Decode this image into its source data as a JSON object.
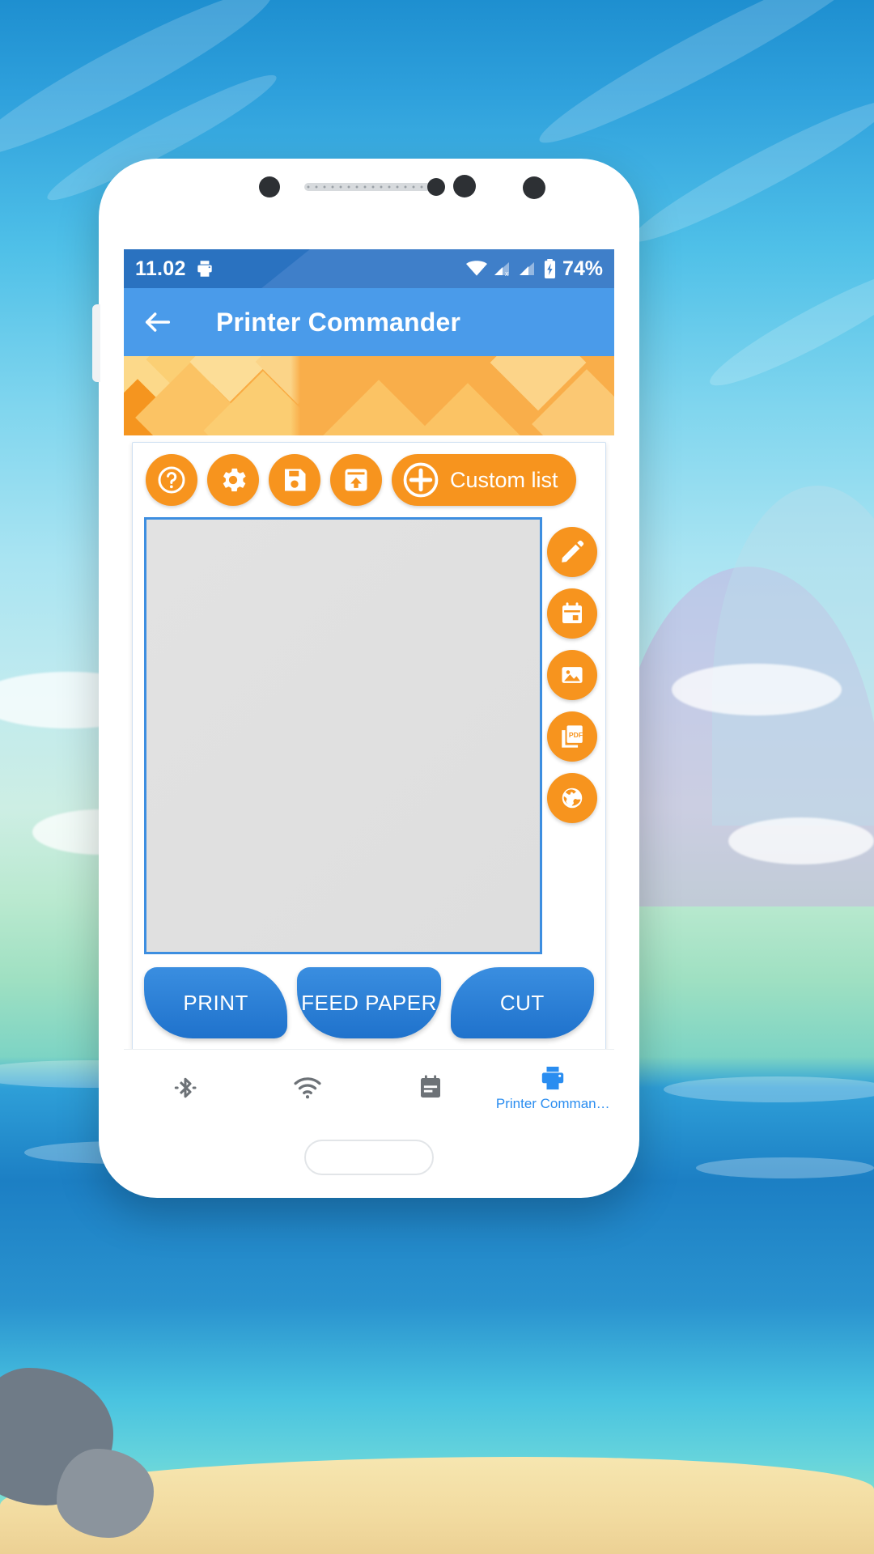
{
  "statusbar": {
    "time": "11.02",
    "printer_icon": "printer-icon",
    "wifi_icon": "wifi-icon",
    "signal1_icon": "cellular-signal-1-icon",
    "signal2_icon": "cellular-signal-2-icon",
    "battery_icon": "battery-charging-icon",
    "battery_text": "74%"
  },
  "appbar": {
    "back_icon": "back-arrow-icon",
    "title": "Printer Commander",
    "bg_color": "#4a9bea"
  },
  "banner": {
    "bg_color": "#f9ab42"
  },
  "toolbar": {
    "buttons": [
      {
        "name": "help-button",
        "icon": "question-mark-icon"
      },
      {
        "name": "settings-button",
        "icon": "gear-icon"
      },
      {
        "name": "save-button",
        "icon": "floppy-disk-icon"
      },
      {
        "name": "load-button",
        "icon": "upload-box-icon"
      }
    ],
    "custom_list": {
      "icon": "plus-circle-icon",
      "label": "Custom list"
    },
    "accent_color": "#f7941e"
  },
  "canvas": {
    "border_color": "#3d8ee0",
    "fill_color": "#e0e0e0",
    "side_buttons": [
      {
        "name": "add-text-button",
        "icon": "pencil-icon"
      },
      {
        "name": "add-date-button",
        "icon": "calendar-icon"
      },
      {
        "name": "add-image-button",
        "icon": "image-icon"
      },
      {
        "name": "add-pdf-button",
        "icon": "pdf-icon"
      },
      {
        "name": "add-web-button",
        "icon": "globe-icon"
      }
    ]
  },
  "actions": [
    {
      "name": "print-button",
      "label": "PRINT"
    },
    {
      "name": "feed-paper-button",
      "label": "FEED PAPER"
    },
    {
      "name": "cut-button",
      "label": "CUT"
    }
  ],
  "bottom_nav": {
    "items": [
      {
        "name": "nav-bluetooth",
        "icon": "bluetooth-icon",
        "label": "",
        "active": false
      },
      {
        "name": "nav-wifi",
        "icon": "wifi-icon",
        "label": "",
        "active": false
      },
      {
        "name": "nav-notes",
        "icon": "notes-icon",
        "label": "",
        "active": false
      },
      {
        "name": "nav-printer-commander",
        "icon": "printer-icon",
        "label": "Printer Comman…",
        "active": true
      }
    ],
    "active_color": "#2a8df0",
    "inactive_color": "#6d7277"
  }
}
